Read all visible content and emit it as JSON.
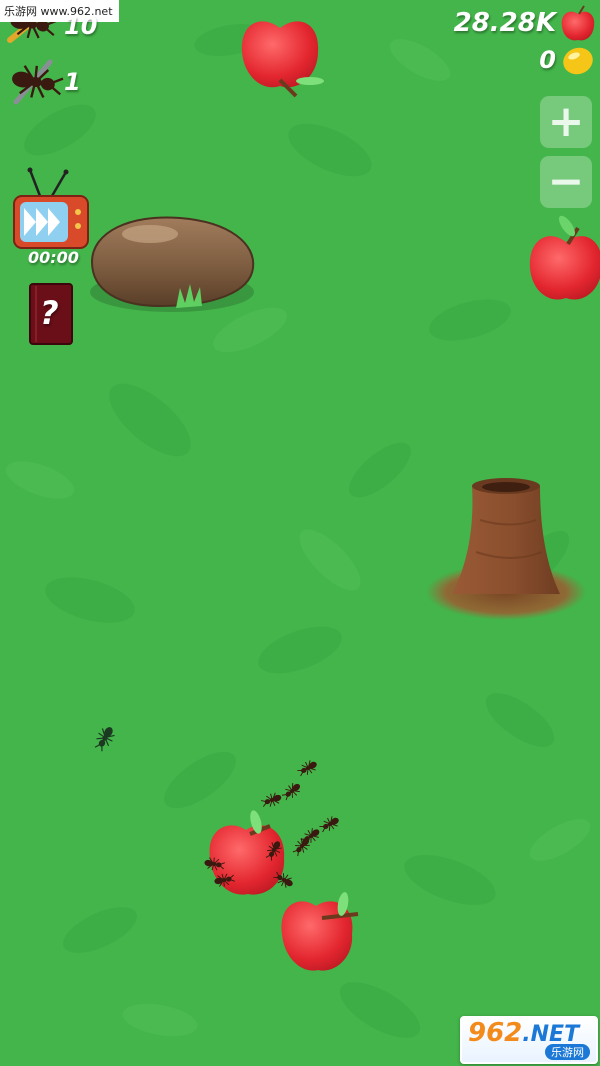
{
  "watermark_top": "乐游网 www.962.net",
  "hud": {
    "worker_ant_count": "10",
    "soldier_ant_count": "1",
    "apple_total": "28.28K",
    "gold_total": "0",
    "zoom_in_label": "+",
    "zoom_out_label": "−",
    "timer": "00:00",
    "help_label": "?"
  },
  "colors": {
    "grass": "#43b54a",
    "apple": "#e8343c",
    "dirt": "#8a5638",
    "rock": "#7a5a3e"
  },
  "icons": [
    "worker-ant-icon",
    "soldier-ant-icon",
    "apple-icon",
    "gold-nugget-icon",
    "tv-fast-forward-icon",
    "help-book-icon"
  ],
  "watermark_bottom": {
    "logo_digits": "962",
    "logo_net": ".NET",
    "subtitle": "乐游网"
  }
}
